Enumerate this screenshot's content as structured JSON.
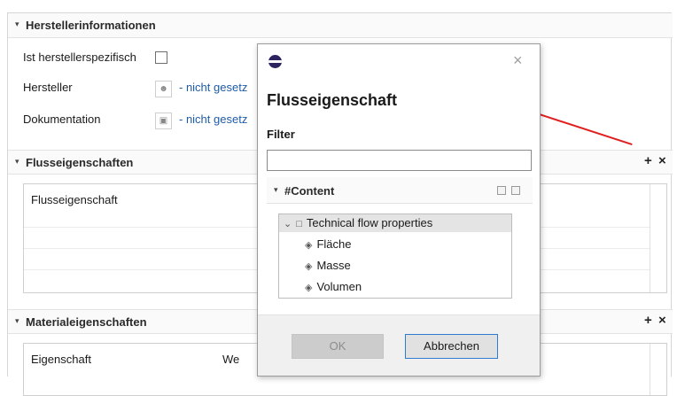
{
  "herstellerinformationen": {
    "title": "Herstellerinformationen",
    "ist_herstellerspezifisch_label": "Ist herstellerspezifisch",
    "hersteller_label": "Hersteller",
    "hersteller_value": "- nicht gesetz",
    "dokumentation_label": "Dokumentation",
    "dokumentation_value": "- nicht gesetz"
  },
  "flusseigenschaften": {
    "title": "Flusseigenschaften",
    "column_header": "Flusseigenschaft",
    "add_label": "+",
    "remove_label": "×"
  },
  "materialeigenschaften": {
    "title": "Materialeigenschaften",
    "column_header_1": "Eigenschaft",
    "column_header_2": "We",
    "add_label": "+",
    "remove_label": "×"
  },
  "dialog": {
    "title": "Flusseigenschaft",
    "close_label": "×",
    "filter_label": "Filter",
    "filter_value": "",
    "content_section_title": "#Content",
    "tree": {
      "root": "Technical flow properties",
      "children": [
        "Fläche",
        "Masse",
        "Volumen"
      ]
    },
    "ok_label": "OK",
    "cancel_label": "Abbrechen"
  },
  "colors": {
    "link": "#1f5ca8",
    "annotation_arrow": "#e02020",
    "focus_border": "#2f7bd3"
  }
}
